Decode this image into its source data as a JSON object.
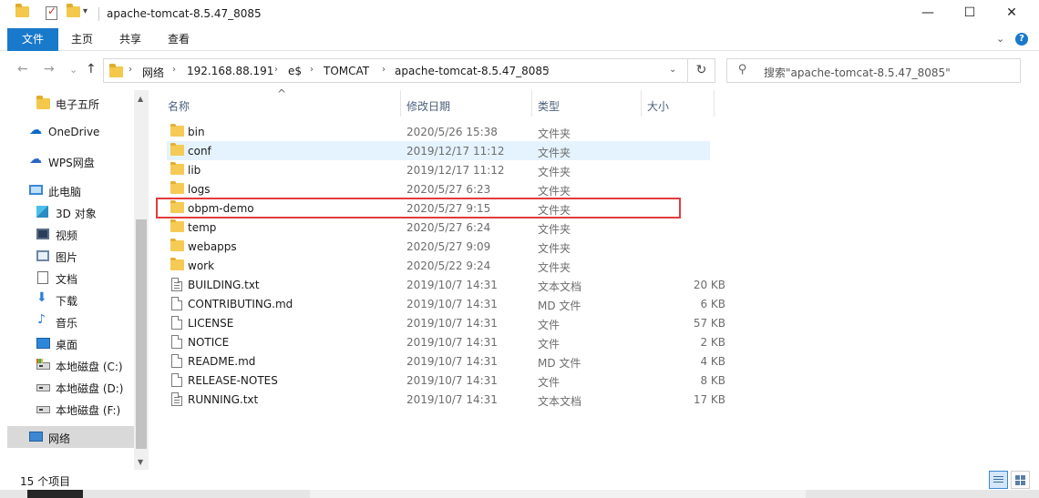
{
  "window": {
    "title": "apache-tomcat-8.5.47_8085",
    "minimize_glyph": "—",
    "maximize_glyph": "☐",
    "close_glyph": "✕"
  },
  "ribbon": {
    "tabs": [
      {
        "label": "文件"
      },
      {
        "label": "主页"
      },
      {
        "label": "共享"
      },
      {
        "label": "查看"
      }
    ],
    "expand_glyph": "⌄",
    "help_glyph": "?"
  },
  "nav": {
    "back_glyph": "←",
    "forward_glyph": "→",
    "recent_glyph": "⌄",
    "up_glyph": "↑"
  },
  "address": {
    "crumbs": [
      "网络",
      "192.168.88.191",
      "e$",
      "TOMCAT",
      "apache-tomcat-8.5.47_8085"
    ],
    "separator": "›",
    "dropdown_glyph": "⌄",
    "refresh_glyph": "↻"
  },
  "search": {
    "placeholder": "搜索\"apache-tomcat-8.5.47_8085\"",
    "icon_glyph": "⚲"
  },
  "sidebar": {
    "items": [
      {
        "label": "电子五所",
        "icon": "folder-icon"
      },
      {
        "label": "OneDrive",
        "icon": "onedrive-icon",
        "glyph": "☁"
      },
      {
        "label": "WPS网盘",
        "icon": "wps-cloud-icon",
        "glyph": "☁"
      },
      {
        "label": "此电脑",
        "icon": "this-pc-icon"
      },
      {
        "label": "3D 对象",
        "icon": "3d-objects-icon"
      },
      {
        "label": "视频",
        "icon": "videos-icon"
      },
      {
        "label": "图片",
        "icon": "pictures-icon"
      },
      {
        "label": "文档",
        "icon": "documents-icon"
      },
      {
        "label": "下载",
        "icon": "downloads-icon",
        "glyph": "⬇"
      },
      {
        "label": "音乐",
        "icon": "music-icon",
        "glyph": "♪"
      },
      {
        "label": "桌面",
        "icon": "desktop-icon"
      },
      {
        "label": "本地磁盘 (C:)",
        "icon": "drive-c-icon"
      },
      {
        "label": "本地磁盘 (D:)",
        "icon": "drive-d-icon"
      },
      {
        "label": "本地磁盘 (F:)",
        "icon": "drive-f-icon"
      },
      {
        "label": "网络",
        "icon": "network-icon"
      }
    ],
    "selected": "网络",
    "scroll_up_glyph": "▲",
    "scroll_down_glyph": "▼"
  },
  "columns": {
    "name": "名称",
    "date": "修改日期",
    "type": "类型",
    "size": "大小",
    "sort_glyph": "^"
  },
  "files": [
    {
      "name": "bin",
      "date": "2020/5/26 15:38",
      "type": "文件夹",
      "size": "",
      "kind": "folder"
    },
    {
      "name": "conf",
      "date": "2019/12/17 11:12",
      "type": "文件夹",
      "size": "",
      "kind": "folder"
    },
    {
      "name": "lib",
      "date": "2019/12/17 11:12",
      "type": "文件夹",
      "size": "",
      "kind": "folder"
    },
    {
      "name": "logs",
      "date": "2020/5/27 6:23",
      "type": "文件夹",
      "size": "",
      "kind": "folder"
    },
    {
      "name": "obpm-demo",
      "date": "2020/5/27 9:15",
      "type": "文件夹",
      "size": "",
      "kind": "folder"
    },
    {
      "name": "temp",
      "date": "2020/5/27 6:24",
      "type": "文件夹",
      "size": "",
      "kind": "folder"
    },
    {
      "name": "webapps",
      "date": "2020/5/27 9:09",
      "type": "文件夹",
      "size": "",
      "kind": "folder"
    },
    {
      "name": "work",
      "date": "2020/5/22 9:24",
      "type": "文件夹",
      "size": "",
      "kind": "folder"
    },
    {
      "name": "BUILDING.txt",
      "date": "2019/10/7 14:31",
      "type": "文本文档",
      "size": "20 KB",
      "kind": "text"
    },
    {
      "name": "CONTRIBUTING.md",
      "date": "2019/10/7 14:31",
      "type": "MD 文件",
      "size": "6 KB",
      "kind": "file"
    },
    {
      "name": "LICENSE",
      "date": "2019/10/7 14:31",
      "type": "文件",
      "size": "57 KB",
      "kind": "file"
    },
    {
      "name": "NOTICE",
      "date": "2019/10/7 14:31",
      "type": "文件",
      "size": "2 KB",
      "kind": "file"
    },
    {
      "name": "README.md",
      "date": "2019/10/7 14:31",
      "type": "MD 文件",
      "size": "4 KB",
      "kind": "file"
    },
    {
      "name": "RELEASE-NOTES",
      "date": "2019/10/7 14:31",
      "type": "文件",
      "size": "8 KB",
      "kind": "file"
    },
    {
      "name": "RUNNING.txt",
      "date": "2019/10/7 14:31",
      "type": "文本文档",
      "size": "17 KB",
      "kind": "text"
    }
  ],
  "hovered_file": "conf",
  "highlighted_file": "obpm-demo",
  "status": {
    "item_count": "15 个项目"
  },
  "colors": {
    "accent": "#1979ca",
    "highlight_border": "#e23b3b",
    "hover_row": "#e5f3ff",
    "folder": "#f5ca55"
  }
}
